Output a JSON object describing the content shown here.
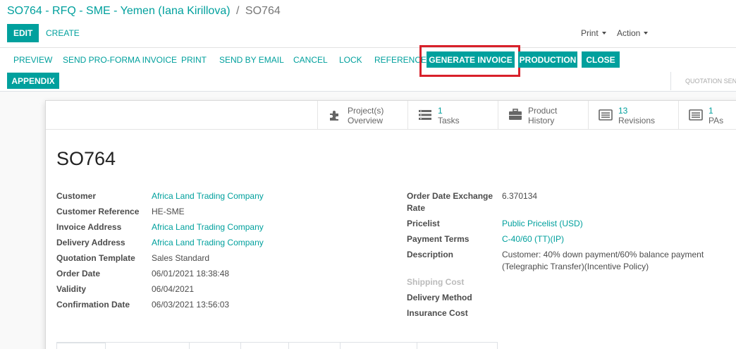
{
  "breadcrumb": {
    "parent": "SO764 - RFQ - SME - Yemen (Iana Kirillova)",
    "separator": "/",
    "current": "SO764"
  },
  "control": {
    "edit_label": "EDIT",
    "create_label": "CREATE",
    "print_label": "Print",
    "action_label": "Action"
  },
  "statusbar": {
    "preview": "PREVIEW",
    "send_proforma": "SEND PRO-FORMA INVOICE",
    "print": "PRINT",
    "send_email": "SEND BY EMAIL",
    "cancel": "CANCEL",
    "lock": "LOCK",
    "reference": "REFERENCE",
    "generate_invoice": "GENERATE INVOICE",
    "production": "PRODUCTION",
    "close": "CLOSE",
    "appendix": "APPENDIX",
    "stage": "QUOTATION SEN"
  },
  "smart_buttons": [
    {
      "line1": "Project(s)",
      "line2": "Overview",
      "icon": "puzzle-icon"
    },
    {
      "line1": "1",
      "line2": "Tasks",
      "icon": "tasks-icon"
    },
    {
      "line1": "Product",
      "line2": "History",
      "icon": "briefcase-icon"
    },
    {
      "line1": "13",
      "line2": "Revisions",
      "icon": "list-icon"
    },
    {
      "line1": "1",
      "line2": "PAs",
      "icon": "list-icon"
    }
  ],
  "record": {
    "name": "SO764",
    "customer_label": "Customer",
    "customer": "Africa Land Trading Company",
    "customer_ref_label": "Customer Reference",
    "customer_ref": "HE-SME",
    "invoice_address_label": "Invoice Address",
    "invoice_address": "Africa Land Trading Company",
    "delivery_address_label": "Delivery Address",
    "delivery_address": "Africa Land Trading Company",
    "quotation_template_label": "Quotation Template",
    "quotation_template": "Sales Standard",
    "order_date_label": "Order Date",
    "order_date": "06/01/2021 18:38:48",
    "validity_label": "Validity",
    "validity": "06/04/2021",
    "confirmation_date_label": "Confirmation Date",
    "confirmation_date": "06/03/2021 13:56:03",
    "exchange_rate_label_1": "Order Date Exchange",
    "exchange_rate_label_2": "Rate",
    "exchange_rate": "6.370134",
    "pricelist_label": "Pricelist",
    "pricelist": "Public Pricelist (USD)",
    "payment_terms_label": "Payment Terms",
    "payment_terms": "C-40/60 (TT)(IP)",
    "description_label": "Description",
    "description_line1": "Customer: 40% down payment/60% balance payment",
    "description_line2": "(Telegraphic Transfer)(Incentive Policy)",
    "shipping_cost_label": "Shipping Cost",
    "delivery_method_label": "Delivery Method",
    "insurance_cost_label": "Insurance Cost"
  },
  "colors": {
    "primary": "#00a09d",
    "highlight": "#d8202a"
  }
}
